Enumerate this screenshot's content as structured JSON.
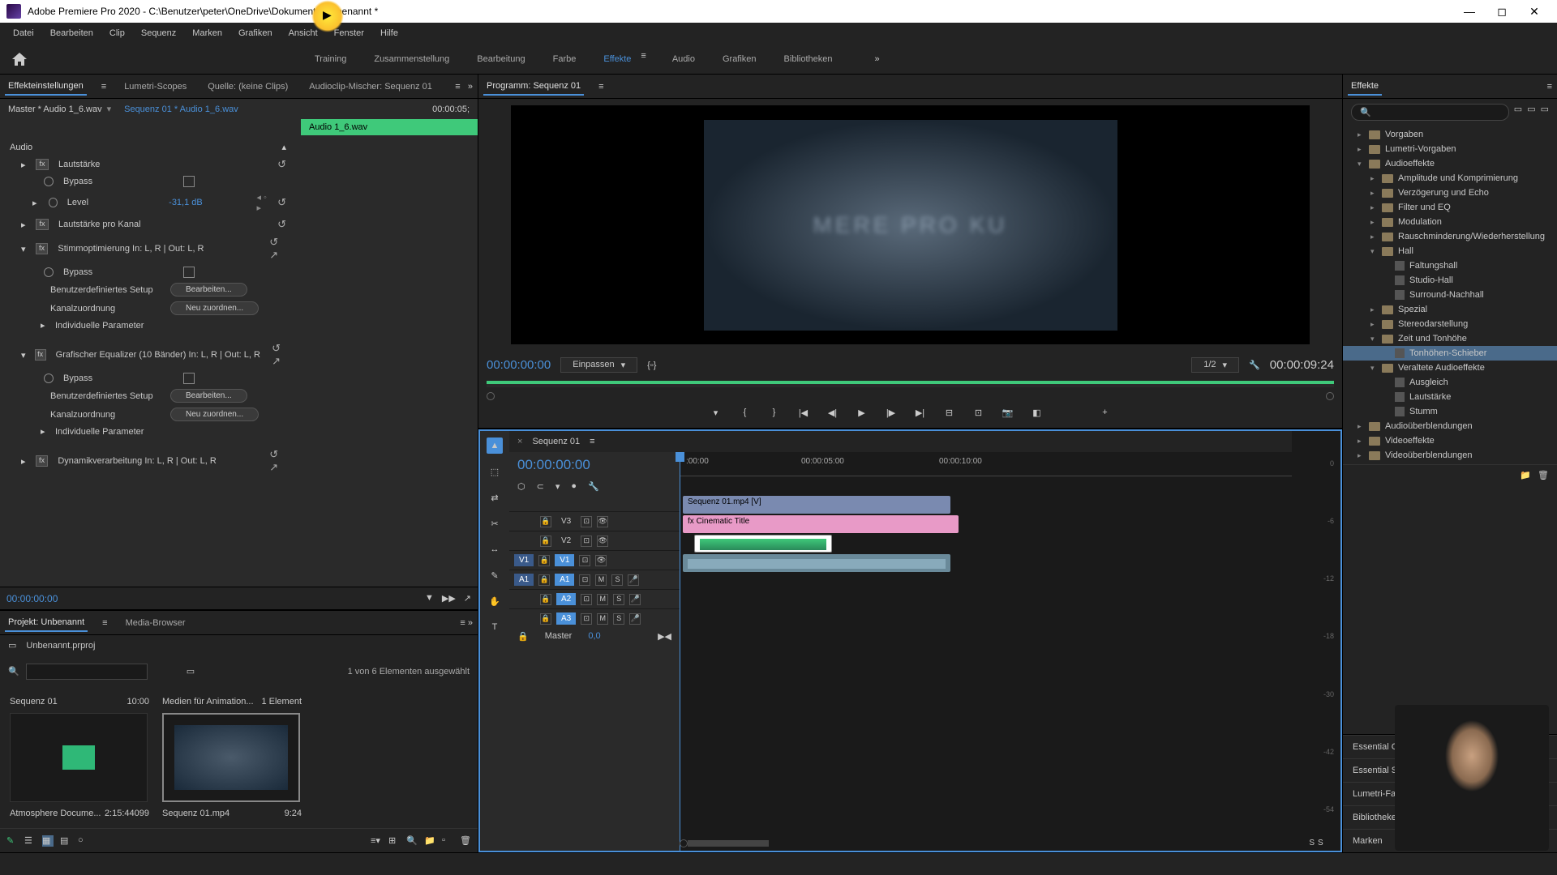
{
  "window": {
    "title": "Adobe Premiere Pro 2020 - C:\\Benutzer\\peter\\OneDrive\\Dokumente\\Unbenannt *"
  },
  "menu": [
    "Datei",
    "Bearbeiten",
    "Clip",
    "Sequenz",
    "Marken",
    "Grafiken",
    "Ansicht",
    "Fenster",
    "Hilfe"
  ],
  "workspaces": [
    "Training",
    "Zusammenstellung",
    "Bearbeitung",
    "Farbe",
    "Effekte",
    "Audio",
    "Grafiken",
    "Bibliotheken"
  ],
  "workspace_active": "Effekte",
  "effect_controls": {
    "tabs": [
      "Effekteinstellungen",
      "Lumetri-Scopes",
      "Quelle: (keine Clips)",
      "Audioclip-Mischer: Sequenz 01"
    ],
    "master": "Master * Audio 1_6.wav",
    "seq": "Sequenz 01 * Audio 1_6.wav",
    "header_time": "00:00:05;",
    "clip_name": "Audio 1_6.wav",
    "section_audio": "Audio",
    "fx_volume": "Lautstärke",
    "bypass": "Bypass",
    "level": "Level",
    "level_val": "-31,1 dB",
    "fx_channel": "Lautstärke pro Kanal",
    "fx_voice": "Stimmoptimierung In: L, R | Out: L, R",
    "custom_setup": "Benutzerdefiniertes Setup",
    "edit_btn": "Bearbeiten...",
    "channel_map": "Kanalzuordnung",
    "remap_btn": "Neu zuordnen...",
    "params": "Individuelle Parameter",
    "fx_eq": "Grafischer Equalizer (10 Bänder) In: L, R | Out: L, R",
    "fx_dyn": "Dynamikverarbeitung In: L, R | Out: L, R",
    "playhead": "00:00:00:00"
  },
  "project": {
    "tabs": [
      "Projekt: Unbenannt",
      "Media-Browser"
    ],
    "file": "Unbenannt.prproj",
    "status": "1 von 6 Elementen ausgewählt",
    "bin1_name": "Sequenz 01",
    "bin1_dur": "10:00",
    "bin2_name": "Medien für Animation...",
    "bin2_info": "1 Element",
    "item1_name": "Atmosphere Docume...",
    "item1_dur": "2:15:44099",
    "item2_name": "Sequenz 01.mp4",
    "item2_dur": "9:24"
  },
  "program": {
    "tab": "Programm: Sequenz 01",
    "preview_text": "MERE PRO KU",
    "tc_left": "00:00:00:00",
    "fit": "Einpassen",
    "zoom": "1/2",
    "tc_right": "00:00:09:24"
  },
  "timeline": {
    "tab": "Sequenz 01",
    "tc": "00:00:00:00",
    "ruler": [
      ":00:00",
      "00:00:05:00",
      "00:00:10:00"
    ],
    "tracks_v": [
      "V3",
      "V2",
      "V1"
    ],
    "tracks_a": [
      "A1",
      "A2",
      "A3"
    ],
    "src_v": "V1",
    "src_a": "A1",
    "clip_v2": "Sequenz 01.mp4 [V]",
    "clip_v1": "Cinematic Title",
    "master": "Master",
    "master_lvl": "0,0"
  },
  "meters": [
    "0",
    "-6",
    "-12",
    "-18",
    "-30",
    "-42",
    "-54"
  ],
  "meters_s": "S",
  "effects": {
    "tab": "Effekte",
    "tree": [
      {
        "l": 0,
        "t": "f",
        "n": "Vorgaben"
      },
      {
        "l": 0,
        "t": "f",
        "n": "Lumetri-Vorgaben"
      },
      {
        "l": 0,
        "t": "f",
        "n": "Audioeffekte",
        "open": true
      },
      {
        "l": 1,
        "t": "f",
        "n": "Amplitude und Komprimierung"
      },
      {
        "l": 1,
        "t": "f",
        "n": "Verzögerung und Echo"
      },
      {
        "l": 1,
        "t": "f",
        "n": "Filter und EQ"
      },
      {
        "l": 1,
        "t": "f",
        "n": "Modulation"
      },
      {
        "l": 1,
        "t": "f",
        "n": "Rauschminderung/Wiederherstellung"
      },
      {
        "l": 1,
        "t": "f",
        "n": "Hall",
        "open": true
      },
      {
        "l": 2,
        "t": "p",
        "n": "Faltungshall"
      },
      {
        "l": 2,
        "t": "p",
        "n": "Studio-Hall"
      },
      {
        "l": 2,
        "t": "p",
        "n": "Surround-Nachhall"
      },
      {
        "l": 1,
        "t": "f",
        "n": "Spezial"
      },
      {
        "l": 1,
        "t": "f",
        "n": "Stereodarstellung"
      },
      {
        "l": 1,
        "t": "f",
        "n": "Zeit und Tonhöhe",
        "open": true
      },
      {
        "l": 2,
        "t": "p",
        "n": "Tonhöhen-Schieber",
        "sel": true
      },
      {
        "l": 1,
        "t": "f",
        "n": "Veraltete Audioeffekte",
        "open": true
      },
      {
        "l": 2,
        "t": "p",
        "n": "Ausgleich"
      },
      {
        "l": 2,
        "t": "p",
        "n": "Lautstärke"
      },
      {
        "l": 2,
        "t": "p",
        "n": "Stumm"
      },
      {
        "l": 0,
        "t": "f",
        "n": "Audioüberblendungen"
      },
      {
        "l": 0,
        "t": "f",
        "n": "Videoeffekte"
      },
      {
        "l": 0,
        "t": "f",
        "n": "Videoüberblendungen"
      }
    ]
  },
  "side_panels": [
    "Essential Grap",
    "Essential Sour",
    "Lumetri-Farbe",
    "Bibliotheken",
    "Marken"
  ]
}
